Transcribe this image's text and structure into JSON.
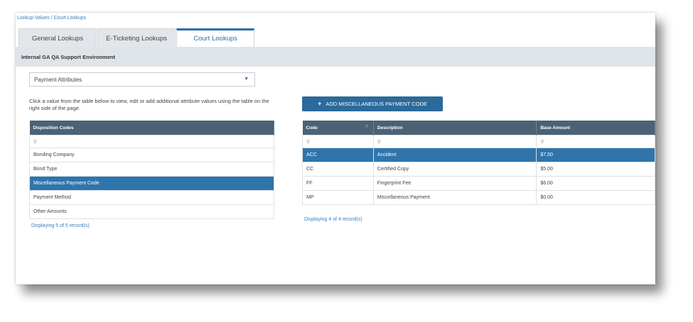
{
  "breadcrumb": "Lookup Values / Court Lookups",
  "tabs": [
    {
      "label": "General Lookups"
    },
    {
      "label": "E-Ticketing Lookups"
    },
    {
      "label": "Court Lookups"
    }
  ],
  "environment": "Internal GA QA Support Environment",
  "attribute_select": {
    "value": "Payment Attributes"
  },
  "instructions": "Click a value from the table below to view, edit or add additional attribute values using the table on the right side of the page.",
  "add_button_label": "ADD MISCELLANEOUS PAYMENT CODE",
  "left_table": {
    "header": "Disposition Codes",
    "rows": [
      "Bonding Company",
      "Bond Type",
      "Miscellaneous Payment Code",
      "Payment Method",
      "Other Amounts"
    ],
    "selected_index": 2,
    "footer": "Displaying 5 of 5 record(s)"
  },
  "right_table": {
    "headers": [
      "Code",
      "Description",
      "Base Amount"
    ],
    "rows": [
      [
        "ACC",
        "Accident",
        "$7.50"
      ],
      [
        "CC",
        "Certified Copy",
        "$5.00"
      ],
      [
        "FF",
        "Fingerprint Fee",
        "$6.00"
      ],
      [
        "MP",
        "Miscellaneous Payment",
        "$0.00"
      ]
    ],
    "selected_index": 0,
    "footer": "Displaying 4 of 4 record(s)"
  },
  "colors": {
    "accent": "#2f75ab",
    "header": "#4b6276"
  }
}
